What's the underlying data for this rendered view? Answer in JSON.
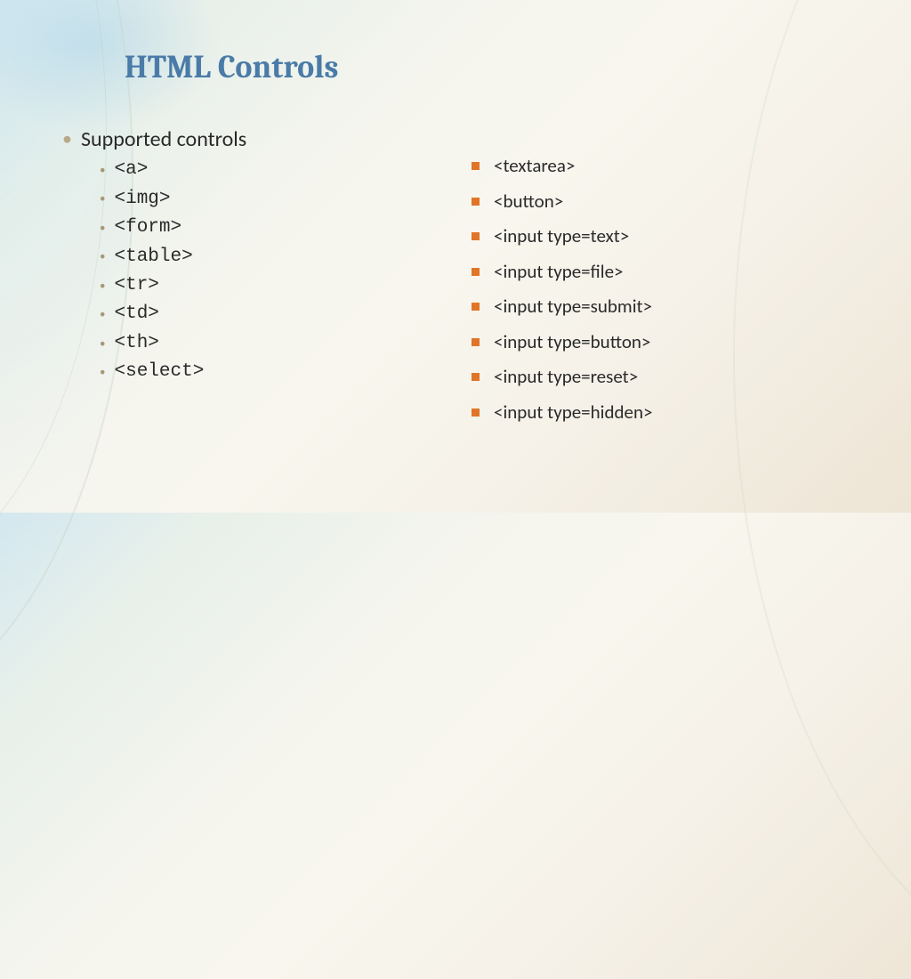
{
  "title": "HTML Controls",
  "mainLabel": "Supported controls",
  "leftItems": [
    "<a>",
    "<img>",
    "<form>",
    "<table>",
    "<tr>",
    "<td>",
    "<th>",
    "<select>"
  ],
  "rightItems": [
    "<textarea>",
    "<button>",
    "<input type=text>",
    "<input type=file>",
    "<input type=submit>",
    "<input type=button>",
    "<input type=reset>",
    "<input type=hidden>"
  ]
}
